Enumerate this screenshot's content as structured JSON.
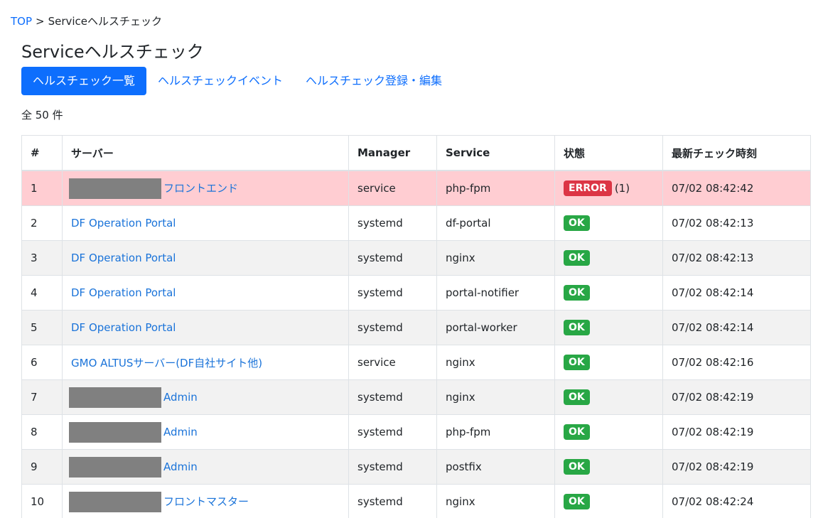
{
  "breadcrumb": {
    "top": "TOP",
    "separator": ">",
    "current": "Serviceヘルスチェック"
  },
  "title": "Serviceヘルスチェック",
  "tabs": [
    {
      "label": "ヘルスチェック一覧",
      "active": true
    },
    {
      "label": "ヘルスチェックイベント",
      "active": false
    },
    {
      "label": "ヘルスチェック登録・編集",
      "active": false
    }
  ],
  "count_label": "全 50 件",
  "table": {
    "headers": [
      "#",
      "サーバー",
      "Manager",
      "Service",
      "状態",
      "最新チェック時刻"
    ],
    "rows": [
      {
        "num": "1",
        "redacted": true,
        "server": "フロントエンド",
        "manager": "service",
        "service": "php-fpm",
        "status": "ERROR",
        "status_count": "(1)",
        "time": "07/02 08:42:42"
      },
      {
        "num": "2",
        "redacted": false,
        "server": "DF Operation Portal",
        "manager": "systemd",
        "service": "df-portal",
        "status": "OK",
        "status_count": "",
        "time": "07/02 08:42:13"
      },
      {
        "num": "3",
        "redacted": false,
        "server": "DF Operation Portal",
        "manager": "systemd",
        "service": "nginx",
        "status": "OK",
        "status_count": "",
        "time": "07/02 08:42:13"
      },
      {
        "num": "4",
        "redacted": false,
        "server": "DF Operation Portal",
        "manager": "systemd",
        "service": "portal-notifier",
        "status": "OK",
        "status_count": "",
        "time": "07/02 08:42:14"
      },
      {
        "num": "5",
        "redacted": false,
        "server": "DF Operation Portal",
        "manager": "systemd",
        "service": "portal-worker",
        "status": "OK",
        "status_count": "",
        "time": "07/02 08:42:14"
      },
      {
        "num": "6",
        "redacted": false,
        "server": "GMO ALTUSサーバー(DF自社サイト他)",
        "manager": "service",
        "service": "nginx",
        "status": "OK",
        "status_count": "",
        "time": "07/02 08:42:16"
      },
      {
        "num": "7",
        "redacted": true,
        "server": "Admin",
        "manager": "systemd",
        "service": "nginx",
        "status": "OK",
        "status_count": "",
        "time": "07/02 08:42:19"
      },
      {
        "num": "8",
        "redacted": true,
        "server": "Admin",
        "manager": "systemd",
        "service": "php-fpm",
        "status": "OK",
        "status_count": "",
        "time": "07/02 08:42:19"
      },
      {
        "num": "9",
        "redacted": true,
        "server": "Admin",
        "manager": "systemd",
        "service": "postfix",
        "status": "OK",
        "status_count": "",
        "time": "07/02 08:42:19"
      },
      {
        "num": "10",
        "redacted": true,
        "server": "フロントマスター",
        "manager": "systemd",
        "service": "nginx",
        "status": "OK",
        "status_count": "",
        "time": "07/02 08:42:24"
      }
    ]
  },
  "colors": {
    "link": "#1a73d9",
    "primary": "#0d6efd",
    "ok": "#28a745",
    "error": "#dc3545",
    "error_row": "#ffcdd2",
    "stripe": "#f2f2f2"
  }
}
